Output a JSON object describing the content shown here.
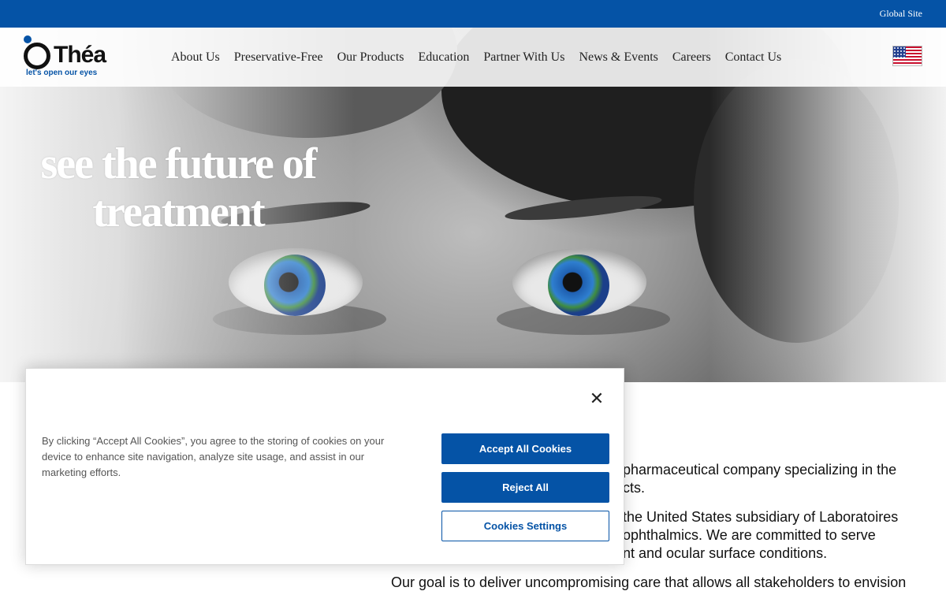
{
  "topbar": {
    "global_site": "Global Site"
  },
  "brand": {
    "name": "Théa",
    "tagline": "let's open our eyes",
    "color": "#0553a6"
  },
  "nav": {
    "items": [
      {
        "label": "About Us"
      },
      {
        "label": "Preservative-Free"
      },
      {
        "label": "Our Products"
      },
      {
        "label": "Education"
      },
      {
        "label": "Partner With Us"
      },
      {
        "label": "News & Events"
      },
      {
        "label": "Careers"
      },
      {
        "label": "Contact Us"
      }
    ],
    "flag_icon": "us-flag-icon"
  },
  "hero": {
    "headline": "see the future of treatment"
  },
  "content": {
    "paragraphs": [
      "pharmaceutical company specializing in the\ncts.",
      "the United States subsidiary of Laboratoires\nophthalmics. We are committed to serve\nnt and ocular surface conditions.",
      "Our goal is to deliver uncompromising care that allows all stakeholders to envision"
    ]
  },
  "cookie_banner": {
    "text": "By clicking “Accept All Cookies”, you agree to the storing of cookies on your device to enhance site navigation, analyze site usage, and assist in our marketing efforts.",
    "accept_label": "Accept All Cookies",
    "reject_label": "Reject All",
    "settings_label": "Cookies Settings",
    "close_icon": "close-icon"
  }
}
